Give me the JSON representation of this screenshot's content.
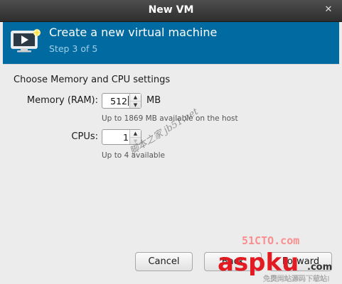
{
  "window": {
    "title": "New VM",
    "close_glyph": "✕"
  },
  "header": {
    "title": "Create a new virtual machine",
    "step": "Step 3 of 5",
    "icon": "monitor-sparkle-icon",
    "accent_color": "#006aa1"
  },
  "content": {
    "section_title": "Choose Memory and CPU settings",
    "memory": {
      "label": "Memory (RAM):",
      "value": "512",
      "unit": "MB",
      "hint": "Up to 1869 MB available on the host"
    },
    "cpus": {
      "label": "CPUs:",
      "value": "1",
      "hint": "Up to 4 available"
    }
  },
  "buttons": {
    "cancel": "Cancel",
    "back": "Back",
    "forward": "Forward"
  },
  "watermarks": {
    "diagonal_text": "脚本之家 jb51.net",
    "site_text": "51CTO.com",
    "logo_text": "aspku",
    "logo_suffix": ".com",
    "logo_tagline": "免费网站源码下载站!"
  }
}
